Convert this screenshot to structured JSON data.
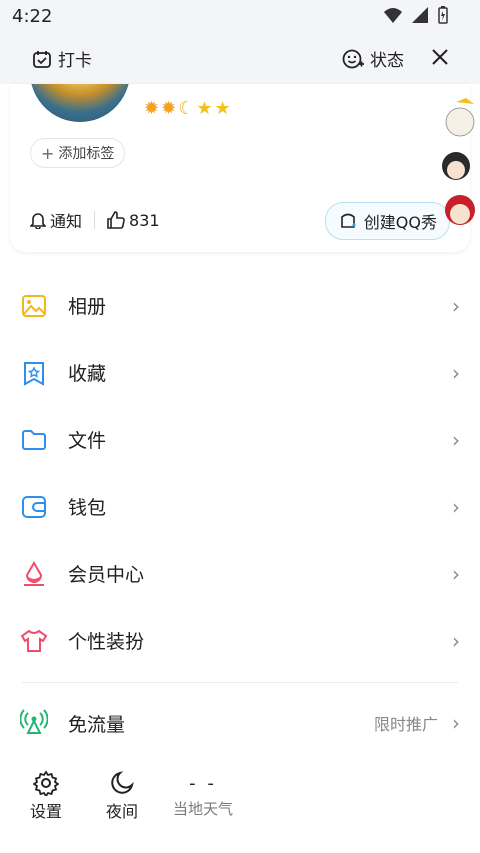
{
  "status": {
    "time": "4:22"
  },
  "topbar": {
    "checkin_label": "打卡",
    "status_label": "状态"
  },
  "profile": {
    "add_tag_label": "添加标签",
    "notify_label": "通知",
    "likes_count": "831",
    "create_qq_show_label": "创建QQ秀"
  },
  "menu": [
    {
      "label": "相册",
      "icon": "album-icon",
      "color": "#f3b61f"
    },
    {
      "label": "收藏",
      "icon": "favorite-icon",
      "color": "#2f8ef0"
    },
    {
      "label": "文件",
      "icon": "folder-icon",
      "color": "#2f8ef0"
    },
    {
      "label": "钱包",
      "icon": "wallet-icon",
      "color": "#2f8ef0"
    },
    {
      "label": "会员中心",
      "icon": "vip-icon",
      "color": "#ee4d6b"
    },
    {
      "label": "个性装扮",
      "icon": "shirt-icon",
      "color": "#ee4d6b"
    }
  ],
  "free_flow": {
    "label": "免流量",
    "promo": "限时推广",
    "icon_color": "#22b573"
  },
  "bottom_tools": [
    {
      "label": "设置",
      "icon": "settings-icon"
    },
    {
      "label": "夜间",
      "icon": "moon-icon"
    },
    {
      "label": "当地天气",
      "icon": "weather-icon",
      "value": "- -"
    }
  ]
}
